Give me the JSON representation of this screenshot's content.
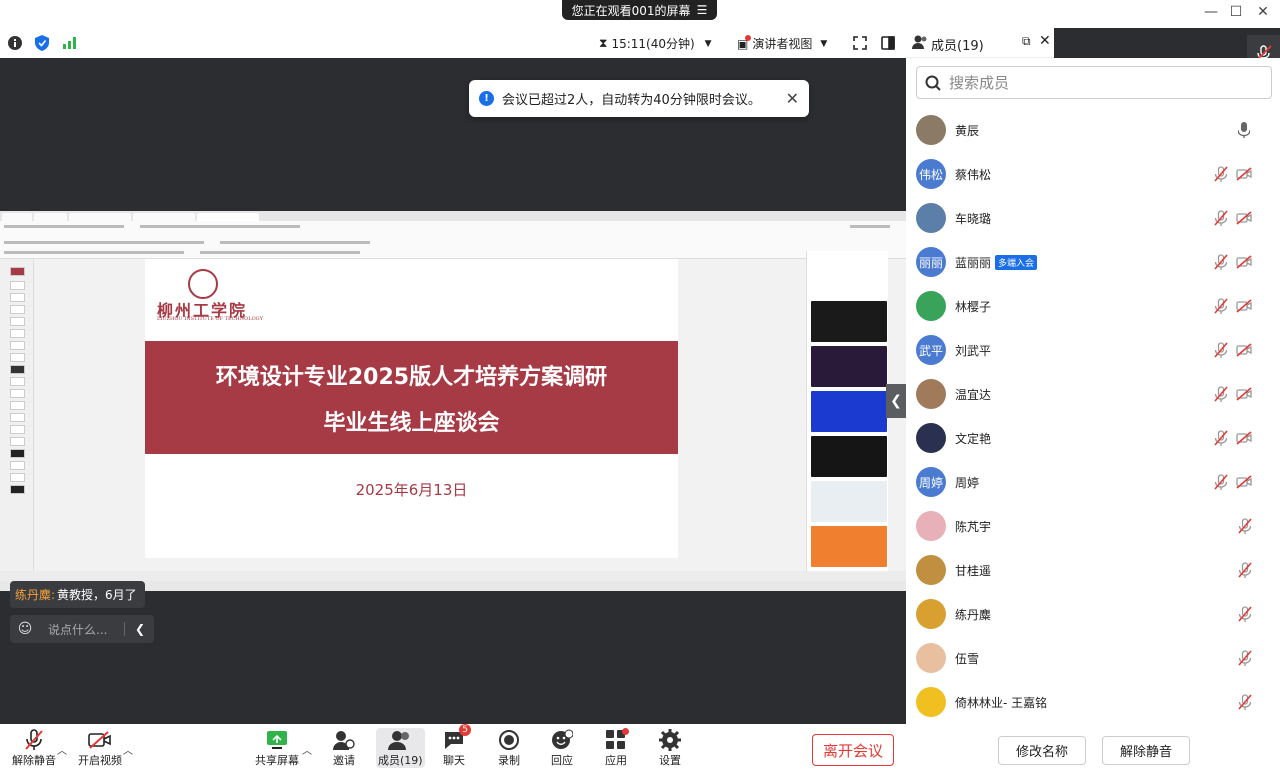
{
  "titlebar": {
    "viewing": "您正在观看001的屏幕",
    "min": "—",
    "max": "☐",
    "close": "✕"
  },
  "topbar": {
    "timer": "15:11(40分钟)",
    "view_mode": "演讲者视图"
  },
  "toast": {
    "text": "会议已超过2人，自动转为40分钟限时会议。"
  },
  "slide": {
    "school_name": "柳州工学院",
    "school_en": "LIUZHOU INSTITUTE OF TECHNOLOGY",
    "title_line1": "环境设计专业2025版人才培养方案调研",
    "title_line2": "毕业生线上座谈会",
    "date": "2025年6月13日"
  },
  "chat": {
    "sender": "练丹麋:",
    "message": "黄教授，6月了",
    "input_placeholder": "说点什么..."
  },
  "toolbar": {
    "unmute": "解除静音",
    "start_video": "开启视频",
    "share": "共享屏幕",
    "invite": "邀请",
    "members": "成员(19)",
    "chat": "聊天",
    "chat_badge": "5",
    "record": "录制",
    "reactions": "回应",
    "apps": "应用",
    "settings": "设置",
    "leave": "离开会议"
  },
  "panel": {
    "title": "成员(19)",
    "search_placeholder": "搜索成员",
    "rename": "修改名称",
    "unmute": "解除静音"
  },
  "members": [
    {
      "name": "黄辰",
      "avatar_text": "",
      "avatar_color": "#8a7a66",
      "mic": "on",
      "cam": false
    },
    {
      "name": "蔡伟松",
      "avatar_text": "伟松",
      "avatar_color": "#4a7bd0",
      "mic": "off",
      "cam": true
    },
    {
      "name": "车晓璐",
      "avatar_text": "",
      "avatar_color": "#5b7fa8",
      "mic": "off",
      "cam": true
    },
    {
      "name": "蓝丽丽",
      "avatar_text": "丽丽",
      "avatar_color": "#4a7bd0",
      "mic": "off",
      "cam": true,
      "badge": "多端入会"
    },
    {
      "name": "林樱子",
      "avatar_text": "",
      "avatar_color": "#3aa35a",
      "mic": "off",
      "cam": true
    },
    {
      "name": "刘武平",
      "avatar_text": "武平",
      "avatar_color": "#4a7bd0",
      "mic": "off",
      "cam": true
    },
    {
      "name": "温宜达",
      "avatar_text": "",
      "avatar_color": "#a07a5a",
      "mic": "off",
      "cam": true
    },
    {
      "name": "文定艳",
      "avatar_text": "",
      "avatar_color": "#2a3050",
      "mic": "off",
      "cam": true
    },
    {
      "name": "周婷",
      "avatar_text": "周婷",
      "avatar_color": "#4a7bd0",
      "mic": "off",
      "cam": true
    },
    {
      "name": "陈芃宇",
      "avatar_text": "",
      "avatar_color": "#e8b0b8",
      "mic": "off",
      "cam": false
    },
    {
      "name": "甘桂遥",
      "avatar_text": "",
      "avatar_color": "#c09040",
      "mic": "off",
      "cam": false
    },
    {
      "name": "练丹麋",
      "avatar_text": "",
      "avatar_color": "#d8a030",
      "mic": "off",
      "cam": false
    },
    {
      "name": "伍雪",
      "avatar_text": "",
      "avatar_color": "#e8c0a0",
      "mic": "off",
      "cam": false
    },
    {
      "name": "倚林林业- 王嘉铭",
      "avatar_text": "",
      "avatar_color": "#f0c020",
      "mic": "off",
      "cam": false
    }
  ]
}
